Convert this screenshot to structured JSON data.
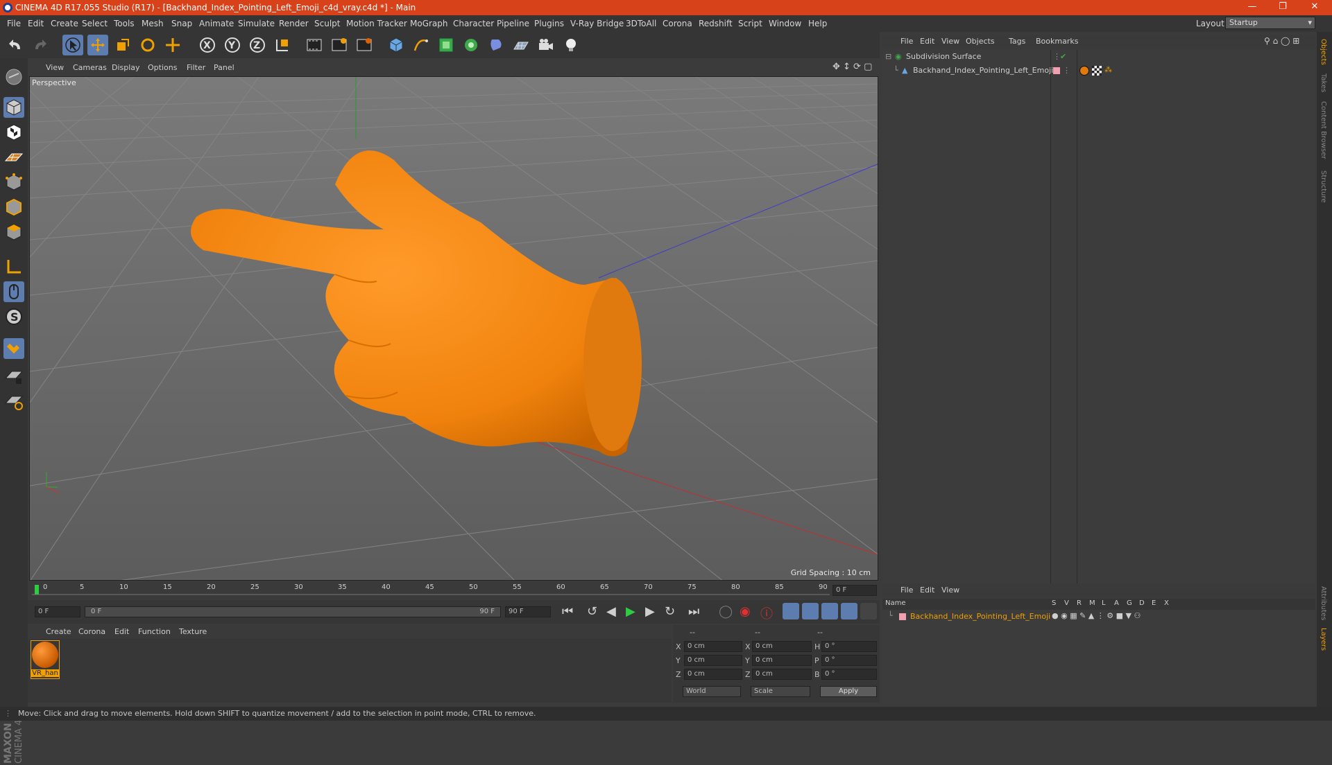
{
  "window": {
    "title": "CINEMA 4D R17.055 Studio (R17) - [Backhand_Index_Pointing_Left_Emoji_c4d_vray.c4d *] - Main"
  },
  "menu": [
    "File",
    "Edit",
    "Create",
    "Select",
    "Tools",
    "Mesh",
    "Snap",
    "Animate",
    "Simulate",
    "Render",
    "Sculpt",
    "Motion Tracker",
    "MoGraph",
    "Character",
    "Pipeline",
    "Plugins",
    "V-Ray Bridge",
    "3DToAll",
    "Corona",
    "Redshift",
    "Script",
    "Window",
    "Help"
  ],
  "layout": {
    "label": "Layout:",
    "value": "Startup"
  },
  "viewport": {
    "menu": [
      "View",
      "Cameras",
      "Display",
      "Options",
      "Filter",
      "Panel"
    ],
    "label": "Perspective",
    "grid_spacing": "Grid Spacing : 10 cm"
  },
  "timeline": {
    "ticks": [
      "0",
      "5",
      "10",
      "15",
      "20",
      "25",
      "30",
      "35",
      "40",
      "45",
      "50",
      "55",
      "60",
      "65",
      "70",
      "75",
      "80",
      "85",
      "90"
    ],
    "current_frame": "0 F",
    "start_field": "0 F",
    "range_start": "0 F",
    "range_end": "90 F",
    "end_field": "90 F"
  },
  "material_manager": {
    "menu": [
      "Create",
      "Corona",
      "Edit",
      "Function",
      "Texture"
    ],
    "materials": [
      {
        "label": "VR_han"
      }
    ]
  },
  "coordinates": {
    "headers": [
      "--",
      "--",
      "--"
    ],
    "rows": [
      {
        "a": "X",
        "av": "0 cm",
        "b": "X",
        "bv": "0 cm",
        "c": "H",
        "cv": "0 °"
      },
      {
        "a": "Y",
        "av": "0 cm",
        "b": "Y",
        "bv": "0 cm",
        "c": "P",
        "cv": "0 °"
      },
      {
        "a": "Z",
        "av": "0 cm",
        "b": "Z",
        "bv": "0 cm",
        "c": "B",
        "cv": "0 °"
      }
    ],
    "mode1": "World",
    "mode2": "Scale",
    "apply": "Apply"
  },
  "object_manager": {
    "menu": [
      "File",
      "Edit",
      "View",
      "Objects",
      "Tags",
      "Bookmarks"
    ],
    "objects": [
      {
        "name": "Subdivision Surface"
      },
      {
        "name": "Backhand_Index_Pointing_Left_Emoji"
      }
    ]
  },
  "layer_manager": {
    "menu": [
      "File",
      "Edit",
      "View"
    ],
    "columns": [
      "Name",
      "S",
      "V",
      "R",
      "M",
      "L",
      "A",
      "G",
      "D",
      "E",
      "X"
    ],
    "layers": [
      {
        "name": "Backhand_Index_Pointing_Left_Emoji",
        "color": "#f0a0b0"
      }
    ]
  },
  "right_tabs": [
    "Objects",
    "Takes",
    "Content Browser",
    "Structure",
    "Attributes",
    "Layers"
  ],
  "status": "Move: Click and drag to move elements. Hold down SHIFT to quantize movement / add to the selection in point mode, CTRL to remove.",
  "brand": {
    "maxon": "MAXON",
    "cinema": "CINEMA 4D"
  },
  "colors": {
    "accent": "#5d7db0",
    "title_bar": "#d8421a",
    "object": "#f28a18",
    "selection": "#f0a000"
  }
}
